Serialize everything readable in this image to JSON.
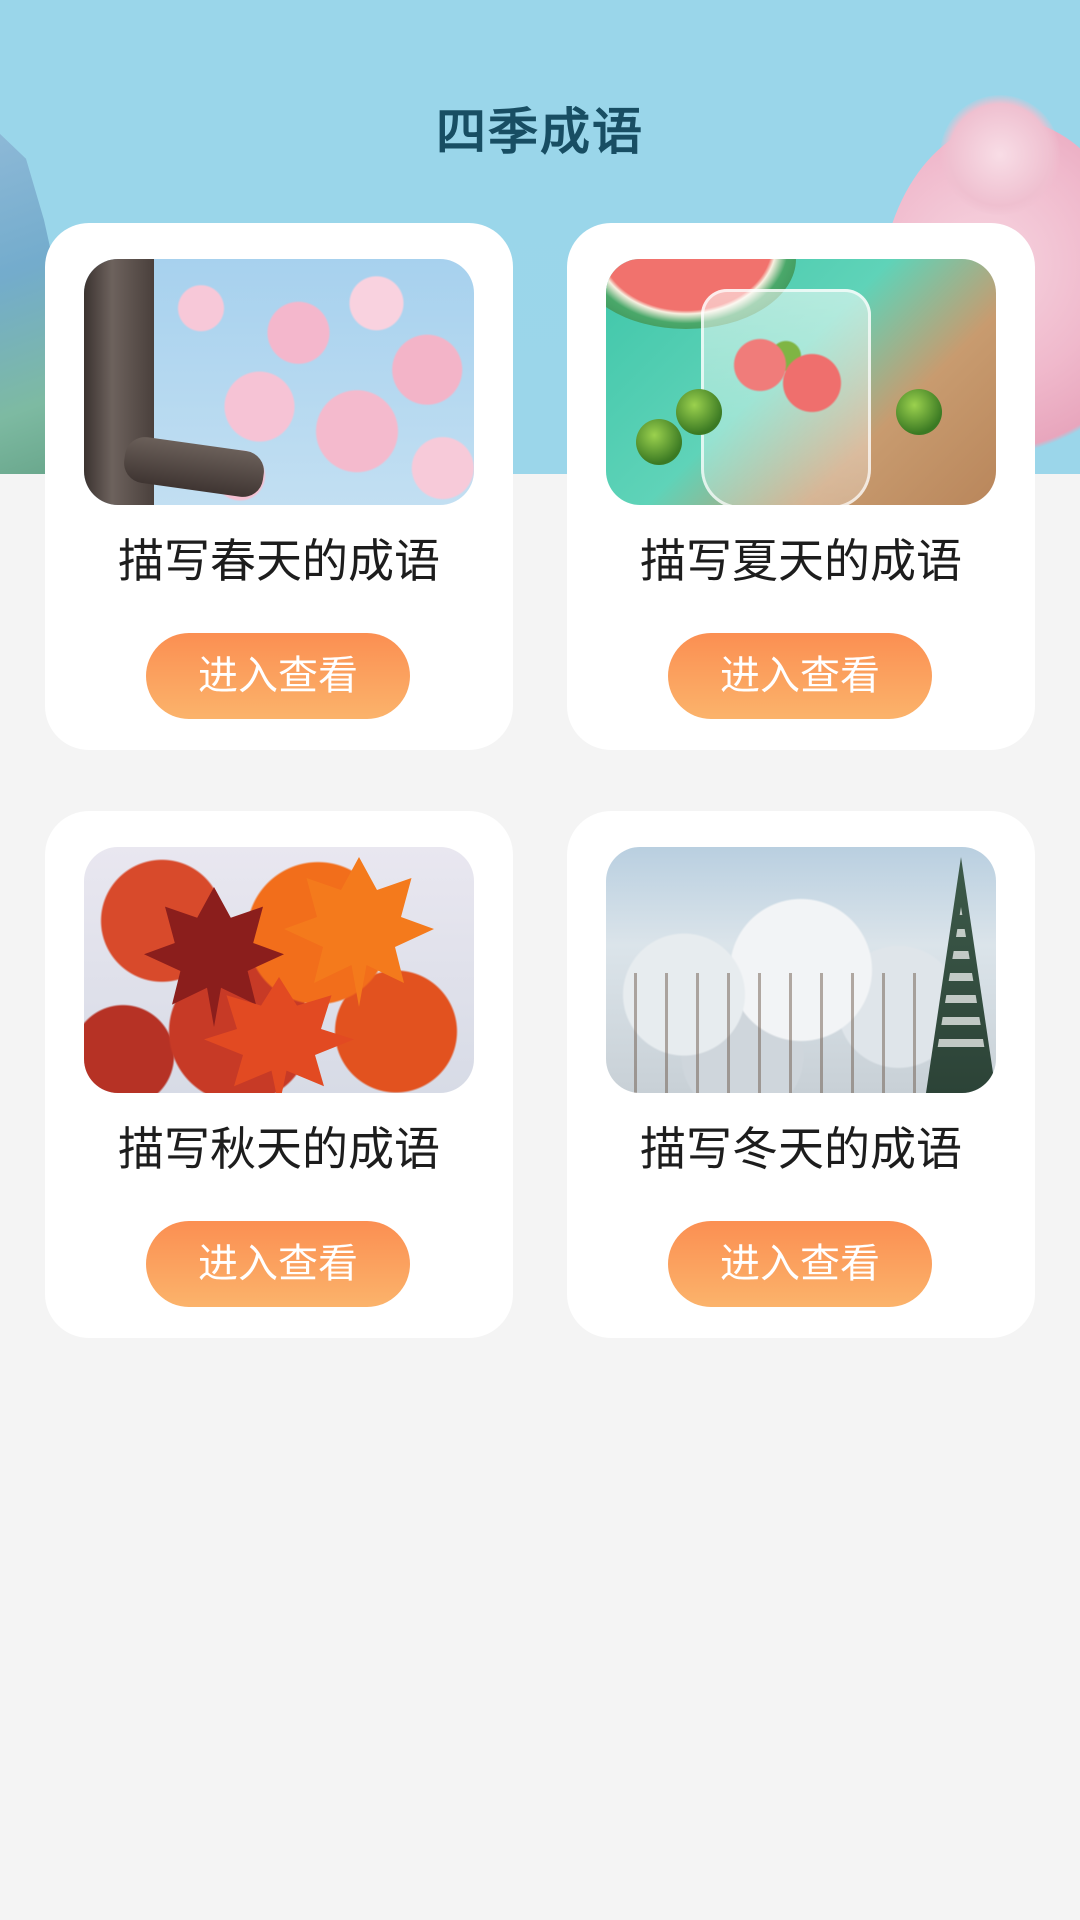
{
  "header": {
    "title": "四季成语"
  },
  "cards": [
    {
      "title": "描写春天的成语",
      "button_label": "进入查看",
      "image": "spring-blossom-image"
    },
    {
      "title": "描写夏天的成语",
      "button_label": "进入查看",
      "image": "summer-drink-image"
    },
    {
      "title": "描写秋天的成语",
      "button_label": "进入查看",
      "image": "autumn-maple-image"
    },
    {
      "title": "描写冬天的成语",
      "button_label": "进入查看",
      "image": "winter-snow-image"
    }
  ],
  "colors": {
    "header_bg": "#9ad6ea",
    "page_bg": "#f4f4f4",
    "title_color": "#184e63",
    "button_gradient_top": "#fb8f52",
    "button_gradient_bottom": "#fbb36b"
  }
}
